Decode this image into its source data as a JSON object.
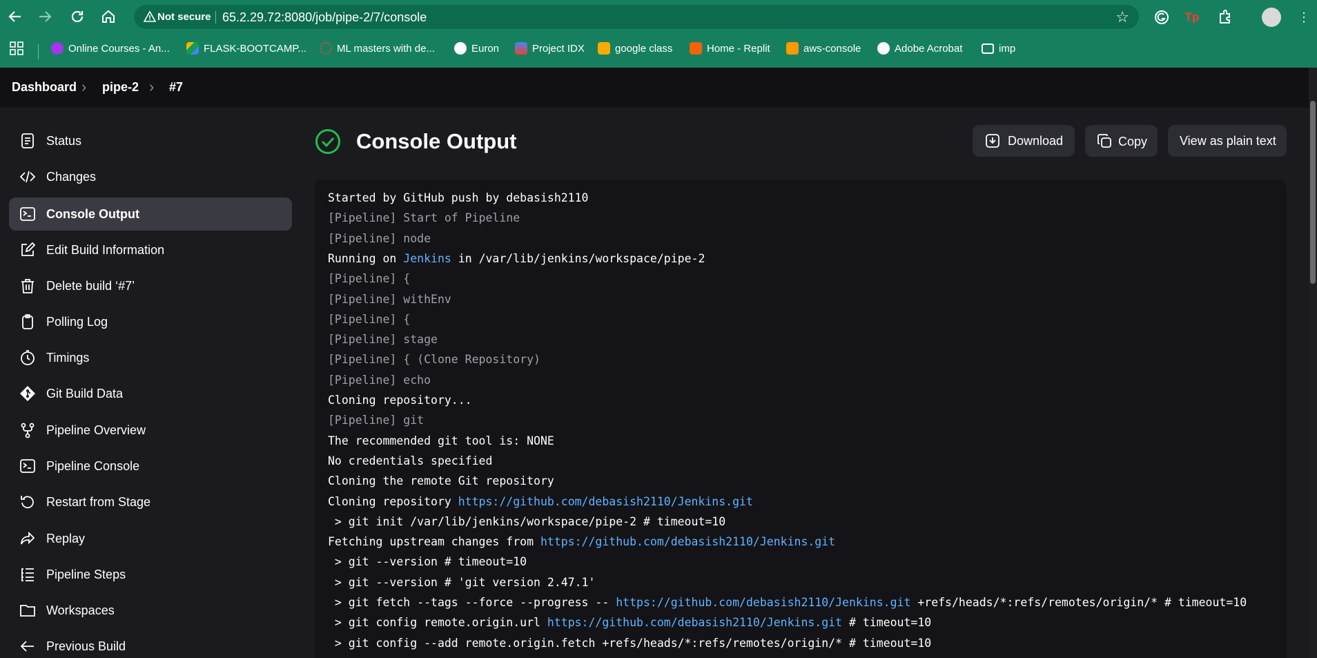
{
  "browser": {
    "security_label": "Not secure",
    "url": "65.2.29.72:8080/job/pipe-2/7/console",
    "bookmarks": [
      {
        "label": "Online Courses - An...",
        "color": "#a435f0"
      },
      {
        "label": "FLASK-BOOTCAMP...",
        "color": "#f4b400"
      },
      {
        "label": "ML masters with de...",
        "color": "#ea4335"
      },
      {
        "label": "Euron",
        "color": "#ffffff"
      },
      {
        "label": "Project IDX",
        "color": "#4285f4"
      },
      {
        "label": "google class",
        "color": "#f9ab00"
      },
      {
        "label": "Home - Replit",
        "color": "#f26207"
      },
      {
        "label": "aws-console",
        "color": "#ff9900"
      },
      {
        "label": "Adobe Acrobat",
        "color": "#ffffff"
      },
      {
        "label": "imp",
        "color": "#ffffff"
      }
    ]
  },
  "breadcrumb": [
    "Dashboard",
    "pipe-2",
    "#7"
  ],
  "sidebar": {
    "items": [
      {
        "label": "Status",
        "icon": "document-icon"
      },
      {
        "label": "Changes",
        "icon": "code-icon"
      },
      {
        "label": "Console Output",
        "icon": "terminal-icon",
        "active": true
      },
      {
        "label": "Edit Build Information",
        "icon": "edit-icon"
      },
      {
        "label": "Delete build ‘#7’",
        "icon": "trash-icon"
      },
      {
        "label": "Polling Log",
        "icon": "clipboard-icon"
      },
      {
        "label": "Timings",
        "icon": "stopwatch-icon"
      },
      {
        "label": "Git Build Data",
        "icon": "git-icon"
      },
      {
        "label": "Pipeline Overview",
        "icon": "branch-icon"
      },
      {
        "label": "Pipeline Console",
        "icon": "terminal-icon"
      },
      {
        "label": "Restart from Stage",
        "icon": "restart-icon"
      },
      {
        "label": "Replay",
        "icon": "replay-icon"
      },
      {
        "label": "Pipeline Steps",
        "icon": "steps-icon"
      },
      {
        "label": "Workspaces",
        "icon": "folder-icon"
      },
      {
        "label": "Previous Build",
        "icon": "arrow-left-icon"
      }
    ]
  },
  "main": {
    "title": "Console Output",
    "download_label": "Download",
    "copy_label": "Copy",
    "plain_label": "View as plain text"
  },
  "console": [
    [
      {
        "t": "Started by GitHub push by debasish2110"
      }
    ],
    [
      {
        "t": "[Pipeline] Start of Pipeline",
        "k": "pl"
      }
    ],
    [
      {
        "t": "[Pipeline] node",
        "k": "pl"
      }
    ],
    [
      {
        "t": "Running on "
      },
      {
        "t": "Jenkins",
        "k": "link"
      },
      {
        "t": " in /var/lib/jenkins/workspace/pipe-2"
      }
    ],
    [
      {
        "t": "[Pipeline] {",
        "k": "pl"
      }
    ],
    [
      {
        "t": "[Pipeline] withEnv",
        "k": "pl"
      }
    ],
    [
      {
        "t": "[Pipeline] {",
        "k": "pl"
      }
    ],
    [
      {
        "t": "[Pipeline] stage",
        "k": "pl"
      }
    ],
    [
      {
        "t": "[Pipeline] { (Clone Repository)",
        "k": "pl"
      }
    ],
    [
      {
        "t": "[Pipeline] echo",
        "k": "pl"
      }
    ],
    [
      {
        "t": "Cloning repository..."
      }
    ],
    [
      {
        "t": "[Pipeline] git",
        "k": "pl"
      }
    ],
    [
      {
        "t": "The recommended git tool is: NONE"
      }
    ],
    [
      {
        "t": "No credentials specified"
      }
    ],
    [
      {
        "t": "Cloning the remote Git repository"
      }
    ],
    [
      {
        "t": "Cloning repository "
      },
      {
        "t": "https://github.com/debasish2110/Jenkins.git",
        "k": "link"
      }
    ],
    [
      {
        "t": " > git init /var/lib/jenkins/workspace/pipe-2 # timeout=10"
      }
    ],
    [
      {
        "t": "Fetching upstream changes from "
      },
      {
        "t": "https://github.com/debasish2110/Jenkins.git",
        "k": "link"
      }
    ],
    [
      {
        "t": " > git --version # timeout=10"
      }
    ],
    [
      {
        "t": " > git --version # 'git version 2.47.1'"
      }
    ],
    [
      {
        "t": " > git fetch --tags --force --progress -- "
      },
      {
        "t": "https://github.com/debasish2110/Jenkins.git",
        "k": "link"
      },
      {
        "t": " +refs/heads/*:refs/remotes/origin/* # timeout=10"
      }
    ],
    [
      {
        "t": " > git config remote.origin.url "
      },
      {
        "t": "https://github.com/debasish2110/Jenkins.git",
        "k": "link"
      },
      {
        "t": " # timeout=10"
      }
    ],
    [
      {
        "t": " > git config --add remote.origin.fetch +refs/heads/*:refs/remotes/origin/* # timeout=10"
      }
    ]
  ]
}
